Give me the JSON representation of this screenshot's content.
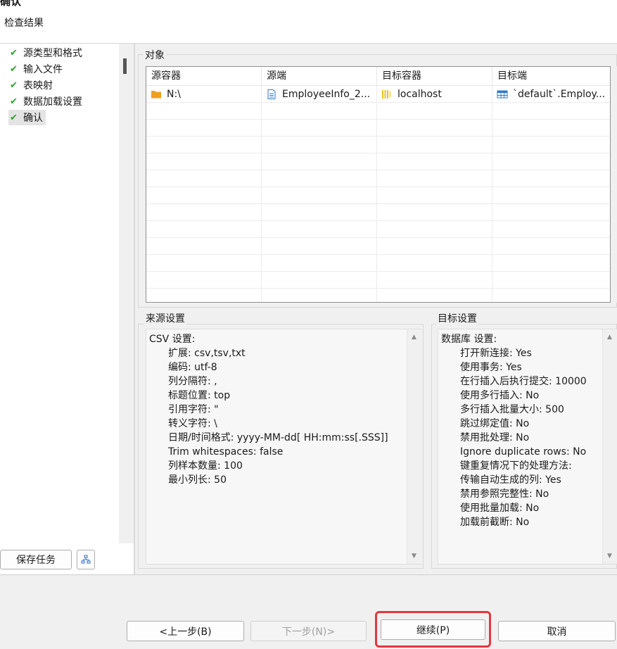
{
  "header": {
    "title": "确认",
    "subtitle": "检查结果"
  },
  "sidebar": {
    "steps": [
      {
        "label": "源类型和格式",
        "done": true
      },
      {
        "label": "输入文件",
        "done": true
      },
      {
        "label": "表映射",
        "done": true
      },
      {
        "label": "数据加载设置",
        "done": true
      },
      {
        "label": "确认",
        "done": true,
        "active": true
      }
    ],
    "save_task_label": "保存任务",
    "tree_icon": "hierarchy-icon",
    "check_icon": "checkmark-icon"
  },
  "objects": {
    "group_label": "对象",
    "columns": [
      "源容器",
      "源端",
      "目标容器",
      "目标端"
    ],
    "rows": [
      {
        "source_container": "N:\\",
        "source": "EmployeeInfo_2...",
        "target_container": "localhost",
        "target": "`default`.Employ..."
      }
    ],
    "icons": [
      "folder-icon",
      "file-icon",
      "database-icon",
      "table-icon"
    ]
  },
  "source_settings": {
    "group_label": "来源设置",
    "heading": "CSV 设置:",
    "lines": [
      "扩展: csv,tsv,txt",
      "编码: utf-8",
      "列分隔符: ,",
      "标题位置: top",
      "引用字符: \"",
      "转义字符: \\",
      "日期/时间格式: yyyy-MM-dd[ HH:mm:ss[.SSS]]",
      "Trim whitespaces: false",
      "列样本数量: 100",
      "最小列长: 50"
    ]
  },
  "target_settings": {
    "group_label": "目标设置",
    "heading": "数据库 设置:",
    "lines": [
      "打开新连接: Yes",
      "使用事务: Yes",
      "在行插入后执行提交: 10000",
      "使用多行插入: No",
      "多行插入批量大小: 500",
      "跳过绑定值: No",
      "禁用批处理: No",
      "Ignore duplicate rows: No",
      "键重复情况下的处理方法:",
      "传输自动生成的列: Yes",
      "禁用参照完整性: No",
      "使用批量加载: No",
      "加载前截断: No"
    ]
  },
  "footer": {
    "prev_label": "<上一步(B)",
    "next_label": "下一步(N)>",
    "continue_label": "继续(P)",
    "cancel_label": "取消"
  },
  "colors": {
    "check": "#2fa02f",
    "highlight": "#e0393e",
    "folder": "#f0a020",
    "file": "#2b79d0",
    "database": "#e8c020",
    "table": "#2b79d0"
  }
}
